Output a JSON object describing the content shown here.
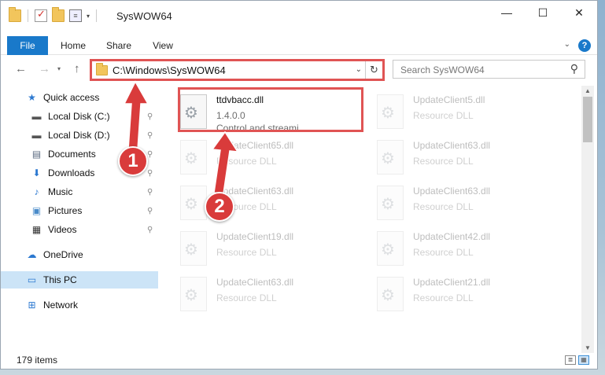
{
  "window": {
    "title": "SysWOW64",
    "controls": {
      "minimize": "—",
      "maximize": "☐",
      "close": "✕"
    }
  },
  "quick_access_toolbar": {
    "dropdown_glyph": "▾"
  },
  "ribbon": {
    "tabs": [
      "File",
      "Home",
      "Share",
      "View"
    ],
    "expand_glyph": "⌄",
    "help_glyph": "?"
  },
  "navigation": {
    "back_glyph": "←",
    "forward_glyph": "→",
    "recent_glyph": "▾",
    "up_glyph": "↑"
  },
  "address_bar": {
    "path": "C:\\Windows\\SysWOW64",
    "dropdown_glyph": "⌄",
    "refresh_glyph": "↻"
  },
  "search": {
    "placeholder": "Search SysWOW64",
    "icon_glyph": "⚲"
  },
  "sidebar": {
    "items": [
      {
        "label": "Quick access",
        "icon": "star-icon",
        "glyph": "★",
        "color": "#2b78d0",
        "pinned": false
      },
      {
        "label": "Local Disk (C:)",
        "icon": "drive-icon",
        "glyph": "▬",
        "color": "#555555",
        "pinned": true
      },
      {
        "label": "Local Disk (D:)",
        "icon": "drive-icon",
        "glyph": "▬",
        "color": "#555555",
        "pinned": true
      },
      {
        "label": "Documents",
        "icon": "documents-icon",
        "glyph": "▤",
        "color": "#5a6a80",
        "pinned": true
      },
      {
        "label": "Downloads",
        "icon": "download-icon",
        "glyph": "⬇",
        "color": "#2b78d0",
        "pinned": true
      },
      {
        "label": "Music",
        "icon": "music-icon",
        "glyph": "♪",
        "color": "#2b78d0",
        "pinned": true
      },
      {
        "label": "Pictures",
        "icon": "pictures-icon",
        "glyph": "▣",
        "color": "#4a8bc9",
        "pinned": true
      },
      {
        "label": "Videos",
        "icon": "videos-icon",
        "glyph": "▦",
        "color": "#333333",
        "pinned": true
      },
      {
        "label": "OneDrive",
        "icon": "cloud-icon",
        "glyph": "☁",
        "color": "#2b78d0",
        "pinned": false
      },
      {
        "label": "This PC",
        "icon": "computer-icon",
        "glyph": "▭",
        "color": "#2b78d0",
        "pinned": false,
        "selected": true
      },
      {
        "label": "Network",
        "icon": "network-icon",
        "glyph": "⊞",
        "color": "#2b78d0",
        "pinned": false
      }
    ],
    "pin_glyph": "📌"
  },
  "files": [
    {
      "name": "ttdvbacc.dll",
      "line2": "1.4.0.0",
      "line3": "Control and streami...",
      "highlighted": true
    },
    {
      "name": "UpdateClient5.dll",
      "line2": "Resource DLL",
      "line3": ""
    },
    {
      "name": "UpdateClient65.dll",
      "line2": "Resource DLL",
      "line3": ""
    },
    {
      "name": "UpdateClient63.dll",
      "line2": "Resource DLL",
      "line3": ""
    },
    {
      "name": "UpdateClient63.dll",
      "line2": "Resource DLL",
      "line3": ""
    },
    {
      "name": "UpdateClient63.dll",
      "line2": "Resource DLL",
      "line3": ""
    },
    {
      "name": "UpdateClient19.dll",
      "line2": "Resource DLL",
      "line3": ""
    },
    {
      "name": "UpdateClient42.dll",
      "line2": "Resource DLL",
      "line3": ""
    },
    {
      "name": "UpdateClient63.dll",
      "line2": "Resource DLL",
      "line3": ""
    },
    {
      "name": "UpdateClient21.dll",
      "line2": "Resource DLL",
      "line3": ""
    }
  ],
  "status_bar": {
    "item_count": "179 items"
  },
  "callouts": [
    "1",
    "2"
  ],
  "colors": {
    "accent": "#1979ca",
    "annotation_red": "#d93b3b",
    "selection": "#cce4f7"
  }
}
